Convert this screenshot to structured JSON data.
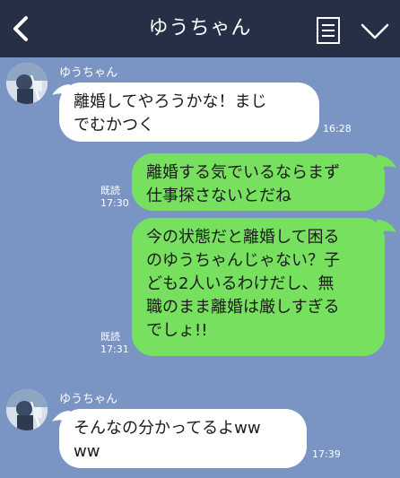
{
  "header": {
    "title": "ゆうちゃん"
  },
  "messages": [
    {
      "sender": "ゆうちゃん",
      "lines": [
        "離婚してやろうかな！まじ",
        "でむかつく"
      ],
      "time": "16:28"
    },
    {
      "lines": [
        "離婚する気でいるならまず",
        "仕事探さないとだね"
      ],
      "read": "既読",
      "time": "17:30"
    },
    {
      "lines": [
        "今の状態だと離婚して困る",
        "のゆうちゃんじゃない？子",
        "ども2人いるわけだし、無",
        "職のまま離婚は厳しすぎる",
        "でしょ!!"
      ],
      "read": "既読",
      "time": "17:31"
    },
    {
      "sender": "ゆうちゃん",
      "lines": [
        "そんなの分かってるよww",
        "ww"
      ],
      "time": "17:39"
    }
  ],
  "colors": {
    "header_bg": "#253047",
    "chat_bg": "#7a95c4",
    "bubble_incoming": "#ffffff",
    "bubble_outgoing": "#77e15f"
  },
  "icons": [
    "back-chevron-icon",
    "notes-icon",
    "chevron-down-icon",
    "avatar"
  ]
}
